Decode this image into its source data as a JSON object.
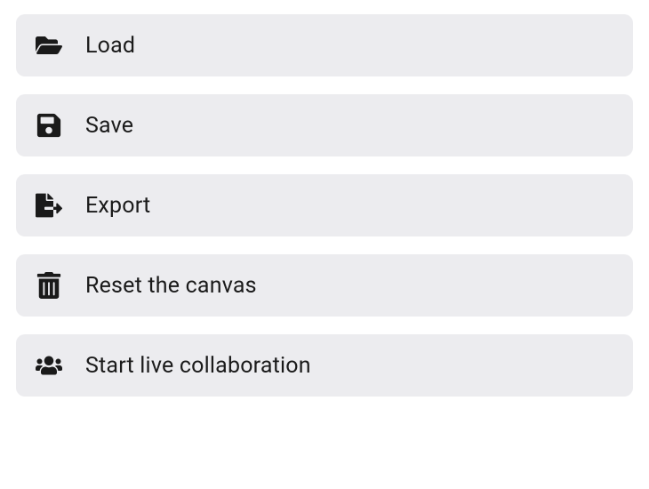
{
  "menu": {
    "items": [
      {
        "id": "load",
        "label": "Load",
        "icon": "folder-open-icon"
      },
      {
        "id": "save",
        "label": "Save",
        "icon": "save-icon"
      },
      {
        "id": "export",
        "label": "Export",
        "icon": "export-icon"
      },
      {
        "id": "reset",
        "label": "Reset the canvas",
        "icon": "trash-icon"
      },
      {
        "id": "collaborate",
        "label": "Start live collaboration",
        "icon": "users-icon"
      }
    ]
  }
}
